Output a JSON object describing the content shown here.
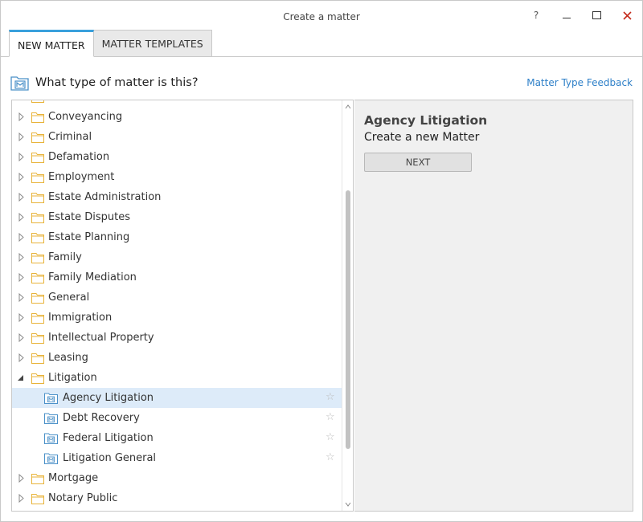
{
  "window": {
    "title": "Create a matter",
    "help_label": "?"
  },
  "tabs": [
    {
      "label": "NEW MATTER",
      "active": true
    },
    {
      "label": "MATTER TEMPLATES",
      "active": false
    }
  ],
  "header": {
    "question": "What type of matter is this?",
    "feedback_link": "Matter Type Feedback"
  },
  "tree": {
    "items": [
      {
        "label": "Conveyancing",
        "type": "folder",
        "expanded": false
      },
      {
        "label": "Criminal",
        "type": "folder",
        "expanded": false
      },
      {
        "label": "Defamation",
        "type": "folder",
        "expanded": false
      },
      {
        "label": "Employment",
        "type": "folder",
        "expanded": false
      },
      {
        "label": "Estate Administration",
        "type": "folder",
        "expanded": false
      },
      {
        "label": "Estate Disputes",
        "type": "folder",
        "expanded": false
      },
      {
        "label": "Estate Planning",
        "type": "folder",
        "expanded": false
      },
      {
        "label": "Family",
        "type": "folder",
        "expanded": false
      },
      {
        "label": "Family Mediation",
        "type": "folder",
        "expanded": false
      },
      {
        "label": "General",
        "type": "folder",
        "expanded": false
      },
      {
        "label": "Immigration",
        "type": "folder",
        "expanded": false
      },
      {
        "label": "Intellectual Property",
        "type": "folder",
        "expanded": false
      },
      {
        "label": "Leasing",
        "type": "folder",
        "expanded": false
      },
      {
        "label": "Litigation",
        "type": "folder",
        "expanded": true
      },
      {
        "label": "Agency Litigation",
        "type": "matter",
        "selected": true
      },
      {
        "label": "Debt Recovery",
        "type": "matter",
        "selected": false
      },
      {
        "label": "Federal Litigation",
        "type": "matter",
        "selected": false
      },
      {
        "label": "Litigation General",
        "type": "matter",
        "selected": false
      },
      {
        "label": "Mortgage",
        "type": "folder",
        "expanded": false
      },
      {
        "label": "Notary Public",
        "type": "folder",
        "expanded": false
      }
    ]
  },
  "detail": {
    "title": "Agency Litigation",
    "subtitle": "Create a new Matter",
    "next_label": "NEXT"
  },
  "colors": {
    "accent": "#39a0dc",
    "link": "#2f80c8",
    "selected_row": "#ddebf9",
    "folder": "#e8b339",
    "matter_icon": "#4a90c8"
  },
  "icons": {
    "help": "help-icon",
    "minimize": "minimize-icon",
    "maximize": "maximize-icon",
    "close": "close-icon",
    "folder": "folder-icon",
    "matter": "matter-type-icon",
    "favorite": "star-icon"
  }
}
